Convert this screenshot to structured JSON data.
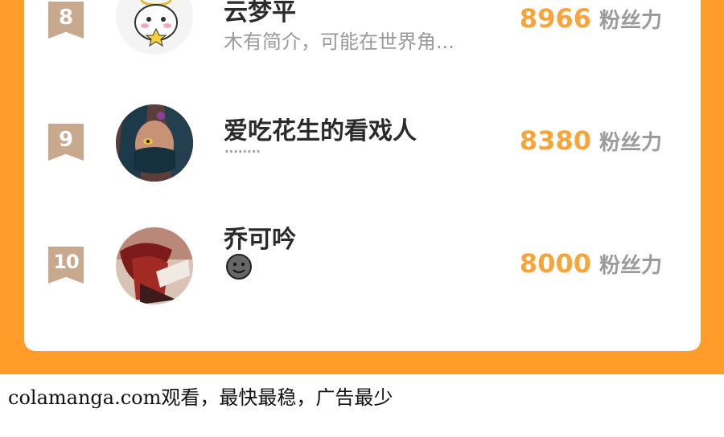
{
  "ranking": {
    "rows": [
      {
        "rank": "8",
        "name": "云梦平",
        "bio": "木有简介，可能在世界角...",
        "fans_count": "8966",
        "fans_label": "粉丝力",
        "avatar": "angel-cat-icon"
      },
      {
        "rank": "9",
        "name": "爱吃花生的看戏人",
        "bio": "........",
        "fans_count": "8380",
        "fans_label": "粉丝力",
        "avatar": "masked-character-icon"
      },
      {
        "rank": "10",
        "name": "乔可吟",
        "bio_icon": "smiley-face-icon",
        "fans_count": "8000",
        "fans_label": "粉丝力",
        "avatar": "red-hair-character-icon"
      }
    ]
  },
  "footer": {
    "text": "colamanga.com观看，最快最稳，广告最少"
  },
  "colors": {
    "frame_orange": "#ff9c2a",
    "fans_orange": "#f7a53a",
    "rank_badge": "#c9a98e",
    "name_text": "#2b2b2b",
    "muted_text": "#9a9a9a"
  }
}
